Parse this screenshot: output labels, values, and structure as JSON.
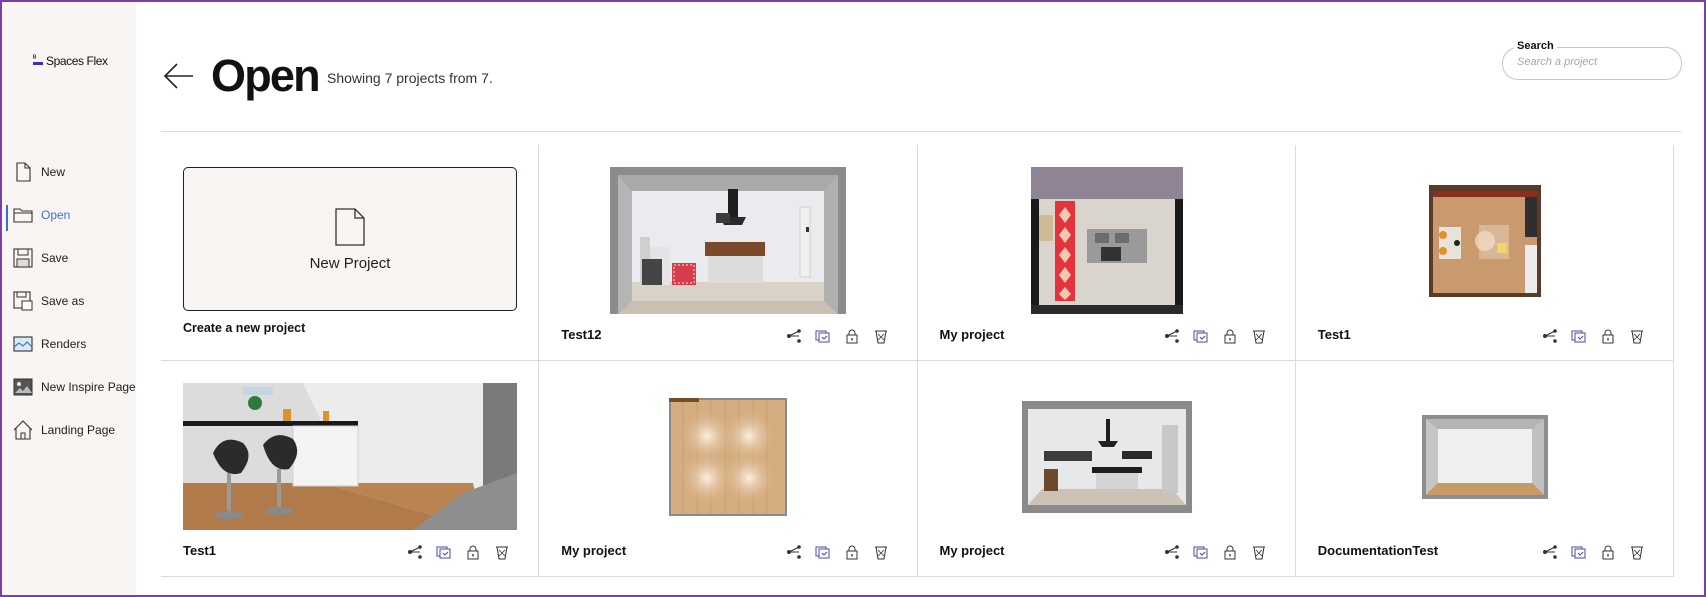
{
  "app": {
    "logo_top": "ᴮ",
    "logo_text": "Spaces Flex"
  },
  "sidebar": {
    "items": [
      {
        "label": "New",
        "icon": "file-icon"
      },
      {
        "label": "Open",
        "icon": "folder-icon",
        "active": true
      },
      {
        "label": "Save",
        "icon": "floppy-icon"
      },
      {
        "label": "Save as",
        "icon": "save-as-icon"
      },
      {
        "label": "Renders",
        "icon": "render-icon"
      },
      {
        "label": "New Inspire Page",
        "icon": "image-icon"
      },
      {
        "label": "Landing Page",
        "icon": "home-icon"
      }
    ]
  },
  "header": {
    "title": "Open",
    "subtitle": "Showing 7 projects from 7.",
    "search_label": "Search",
    "search_placeholder": "Search a project",
    "search_value": ""
  },
  "new_project": {
    "card_label": "New Project",
    "caption": "Create a new project"
  },
  "projects": [
    {
      "name": "Test12",
      "thumb": "kitchen-perspective"
    },
    {
      "name": "My project",
      "thumb": "kitchen-topdown"
    },
    {
      "name": "Test1",
      "thumb": "dining-topdown"
    },
    {
      "name": "Test1",
      "thumb": "bar-stools-closeup"
    },
    {
      "name": "My project",
      "thumb": "empty-floor-topdown"
    },
    {
      "name": "My project",
      "thumb": "kitchen-front"
    },
    {
      "name": "DocumentationTest",
      "thumb": "empty-room"
    }
  ],
  "actions": [
    "share-icon",
    "duplicate-icon",
    "lock-icon",
    "delete-icon"
  ],
  "colors": {
    "accent": "#3d6fd8",
    "sidebar_bg": "#f8f5f2",
    "frame": "#7b3fa5",
    "logo_bar": "#3b2bc4"
  }
}
